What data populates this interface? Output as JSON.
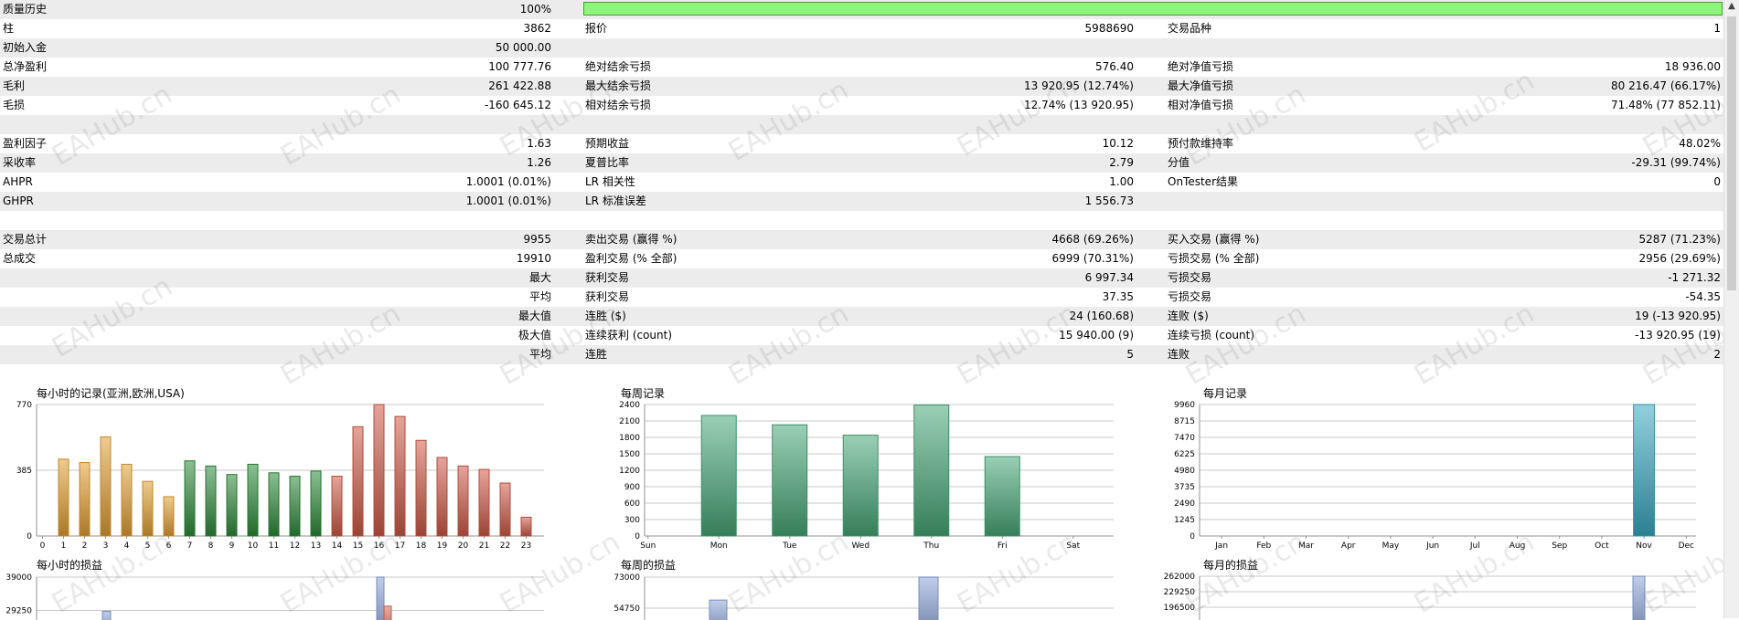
{
  "rows": [
    {
      "shade": true,
      "c1": {
        "label": "质量历史",
        "value": "100%"
      },
      "progress": 1.0
    },
    {
      "shade": false,
      "c1": {
        "label": "柱",
        "value": "3862"
      },
      "c2": {
        "label": "报价",
        "value": "5988690"
      },
      "c3": {
        "label": "交易品种",
        "value": "1"
      }
    },
    {
      "shade": true,
      "c1": {
        "label": "初始入金",
        "value": "50 000.00"
      }
    },
    {
      "shade": false,
      "c1": {
        "label": "总净盈利",
        "value": "100 777.76"
      },
      "c2": {
        "label": "绝对结余亏损",
        "value": "576.40"
      },
      "c3": {
        "label": "绝对净值亏损",
        "value": "18 936.00"
      }
    },
    {
      "shade": true,
      "c1": {
        "label": "毛利",
        "value": "261 422.88"
      },
      "c2": {
        "label": "最大结余亏损",
        "value": "13 920.95 (12.74%)"
      },
      "c3": {
        "label": "最大净值亏损",
        "value": "80 216.47 (66.17%)"
      }
    },
    {
      "shade": false,
      "c1": {
        "label": "毛损",
        "value": "-160 645.12"
      },
      "c2": {
        "label": "相对结余亏损",
        "value": "12.74% (13 920.95)"
      },
      "c3": {
        "label": "相对净值亏损",
        "value": "71.48% (77 852.11)"
      }
    },
    {
      "shade": true
    },
    {
      "shade": false,
      "c1": {
        "label": "盈利因子",
        "value": "1.63"
      },
      "c2": {
        "label": "预期收益",
        "value": "10.12"
      },
      "c3": {
        "label": "预付款维持率",
        "value": "48.02%"
      }
    },
    {
      "shade": true,
      "c1": {
        "label": "采收率",
        "value": "1.26"
      },
      "c2": {
        "label": "夏普比率",
        "value": "2.79"
      },
      "c3": {
        "label": "分值",
        "value": "-29.31 (99.74%)"
      }
    },
    {
      "shade": false,
      "c1": {
        "label": "AHPR",
        "value": "1.0001 (0.01%)"
      },
      "c2": {
        "label": "LR 相关性",
        "value": "1.00"
      },
      "c3": {
        "label": "OnTester结果",
        "value": "0"
      }
    },
    {
      "shade": true,
      "c1": {
        "label": "GHPR",
        "value": "1.0001 (0.01%)"
      },
      "c2": {
        "label": "LR 标准误差",
        "value": "1 556.73"
      }
    },
    {
      "shade": false
    },
    {
      "shade": true,
      "c1": {
        "label": "交易总计",
        "value": "9955"
      },
      "c2": {
        "label": "卖出交易 (赢得 %)",
        "value": "4668 (69.26%)"
      },
      "c3": {
        "label": "买入交易 (赢得 %)",
        "value": "5287 (71.23%)"
      }
    },
    {
      "shade": false,
      "c1": {
        "label": "总成交",
        "value": "19910"
      },
      "c2": {
        "label": "盈利交易 (% 全部)",
        "value": "6999 (70.31%)"
      },
      "c3": {
        "label": "亏损交易 (% 全部)",
        "value": "2956 (29.69%)"
      }
    },
    {
      "shade": true,
      "c1": {
        "label": "",
        "value": "最大"
      },
      "c2": {
        "label": "获利交易",
        "value": "6 997.34"
      },
      "c3": {
        "label": "亏损交易",
        "value": "-1 271.32"
      }
    },
    {
      "shade": false,
      "c1": {
        "label": "",
        "value": "平均"
      },
      "c2": {
        "label": "获利交易",
        "value": "37.35"
      },
      "c3": {
        "label": "亏损交易",
        "value": "-54.35"
      }
    },
    {
      "shade": true,
      "c1": {
        "label": "",
        "value": "最大值"
      },
      "c2": {
        "label": "连胜 ($)",
        "value": "24 (160.68)"
      },
      "c3": {
        "label": "连败 ($)",
        "value": "19 (-13 920.95)"
      }
    },
    {
      "shade": false,
      "c1": {
        "label": "",
        "value": "极大值"
      },
      "c2": {
        "label": "连续获利 (count)",
        "value": "15 940.00 (9)"
      },
      "c3": {
        "label": "连续亏损 (count)",
        "value": "-13 920.95 (19)"
      }
    },
    {
      "shade": true,
      "c1": {
        "label": "",
        "value": "平均"
      },
      "c2": {
        "label": "连胜",
        "value": "5"
      },
      "c3": {
        "label": "连败",
        "value": "2"
      }
    },
    {
      "shade": false
    }
  ],
  "watermark": "EAHub.cn",
  "colors": {
    "progress": "#8ef57c",
    "asia": "#e2a033",
    "europe": "#2e8b3a",
    "usa": "#cf5a48",
    "weekly": "#48a878",
    "monthly": "#3ba9c2",
    "pl_profit": "#8ea6da",
    "pl_loss": "#e06a5a"
  },
  "chart_data": [
    {
      "type": "bar",
      "title": "每小时的记录(亚洲,欧洲,USA)",
      "categories": [
        "0",
        "1",
        "2",
        "3",
        "4",
        "5",
        "6",
        "7",
        "8",
        "9",
        "10",
        "11",
        "12",
        "13",
        "14",
        "15",
        "16",
        "17",
        "18",
        "19",
        "20",
        "21",
        "22",
        "23"
      ],
      "series": [
        {
          "name": "亚洲",
          "values": [
            0,
            450,
            430,
            580,
            420,
            320,
            230,
            null,
            null,
            null,
            null,
            null,
            null,
            null,
            null,
            null,
            null,
            null,
            null,
            null,
            null,
            null,
            null,
            null
          ]
        },
        {
          "name": "欧洲",
          "values": [
            null,
            null,
            null,
            null,
            null,
            null,
            null,
            440,
            410,
            360,
            420,
            370,
            350,
            380,
            null,
            null,
            null,
            null,
            null,
            null,
            null,
            null,
            null,
            null
          ]
        },
        {
          "name": "USA",
          "values": [
            null,
            null,
            null,
            null,
            null,
            null,
            null,
            null,
            null,
            null,
            null,
            null,
            null,
            null,
            350,
            640,
            770,
            700,
            560,
            460,
            410,
            390,
            310,
            110
          ]
        }
      ],
      "yticks": [
        "770",
        "385",
        "0"
      ],
      "ylim": [
        0,
        770
      ]
    },
    {
      "type": "bar",
      "title": "每周记录",
      "categories": [
        "Sun",
        "Mon",
        "Tue",
        "Wed",
        "Thu",
        "Fri",
        "Sat"
      ],
      "values": [
        0,
        2200,
        2030,
        1840,
        2390,
        1450,
        0
      ],
      "yticks": [
        "2400",
        "2100",
        "1800",
        "1500",
        "1200",
        "900",
        "600",
        "300",
        "0"
      ],
      "ylim": [
        0,
        2400
      ]
    },
    {
      "type": "bar",
      "title": "每月记录",
      "categories": [
        "Jan",
        "Feb",
        "Mar",
        "Apr",
        "May",
        "Jun",
        "Jul",
        "Aug",
        "Sep",
        "Oct",
        "Nov",
        "Dec"
      ],
      "values": [
        0,
        0,
        0,
        0,
        0,
        0,
        0,
        0,
        0,
        0,
        9955,
        0
      ],
      "yticks": [
        "9960",
        "8715",
        "7470",
        "6225",
        "4980",
        "3735",
        "2490",
        "1245",
        "0"
      ],
      "ylim": [
        0,
        9960
      ]
    },
    {
      "type": "bar",
      "title": "每小时的损益",
      "yticks": [
        "39000",
        "29250"
      ],
      "ylim_top": 39000,
      "series": [
        {
          "name": "",
          "values": [
            {
              "x": 3,
              "y": 29000
            },
            {
              "x": 16,
              "y": 39000
            }
          ]
        },
        {
          "name": "",
          "values": [
            {
              "x": 16,
              "y": 30500
            }
          ]
        }
      ]
    },
    {
      "type": "bar",
      "title": "每周的损益",
      "yticks": [
        "73000",
        "54750"
      ],
      "ylim_top": 73000,
      "series": [
        {
          "name": "",
          "values": [
            {
              "x": "Mon",
              "y": 59500
            },
            {
              "x": "Thu",
              "y": 73000
            }
          ]
        }
      ]
    },
    {
      "type": "bar",
      "title": "每月的损益",
      "yticks": [
        "262000",
        "229250",
        "196500"
      ],
      "ylim_top": 262000,
      "series": [
        {
          "name": "",
          "values": [
            {
              "x": "Nov",
              "y": 262000
            }
          ]
        }
      ]
    }
  ]
}
